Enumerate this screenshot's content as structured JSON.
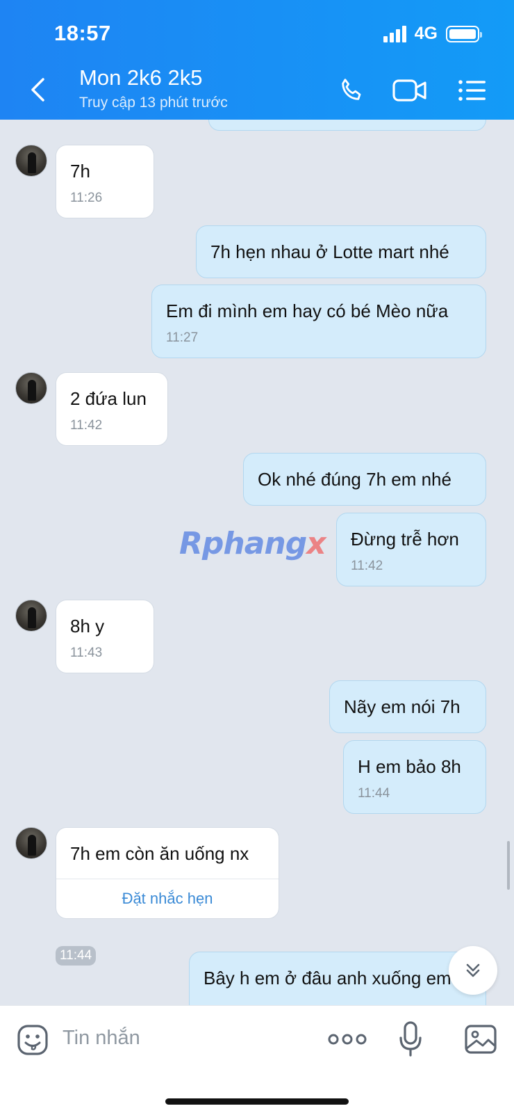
{
  "status": {
    "time": "18:57",
    "network": "4G"
  },
  "header": {
    "title": "Mon 2k6 2k5",
    "subtitle": "Truy cập 13 phút trước"
  },
  "messages": [
    {
      "dir": "in",
      "text": "7h",
      "time": "11:26"
    },
    {
      "dir": "out",
      "text": "7h hẹn nhau ở Lotte mart nhé"
    },
    {
      "dir": "out",
      "text": "Em đi mình em hay có bé Mèo nữa",
      "time": "11:27"
    },
    {
      "dir": "in",
      "text": "2 đứa lun",
      "time": "11:42"
    },
    {
      "dir": "out",
      "text": "Ok nhé đúng 7h em nhé"
    },
    {
      "dir": "out",
      "text": "Đừng trễ hơn",
      "time": "11:42"
    },
    {
      "dir": "in",
      "text": "8h y",
      "time": "11:43"
    },
    {
      "dir": "out",
      "text": "Nãy em nói 7h"
    },
    {
      "dir": "out",
      "text": "H em bảo 8h",
      "time": "11:44"
    },
    {
      "dir": "in",
      "text": "7h em còn ăn uống nx",
      "action": "Đặt nhắc hẹn",
      "time": "11:44"
    },
    {
      "dir": "out",
      "text": "Bây h em ở đâu anh xuống em"
    }
  ],
  "watermark": {
    "main": "Rphang",
    "accent": "x"
  },
  "composer": {
    "placeholder": "Tin nhắn"
  },
  "colors": {
    "header": "#1e84f3",
    "out_bubble": "#d4ecfb",
    "in_bubble": "#ffffff",
    "background": "#e1e6ee",
    "link": "#3a8ad6"
  },
  "icons": [
    "back-icon",
    "phone-icon",
    "video-call-icon",
    "menu-list-icon",
    "chevron-double-down-icon",
    "sticker-icon",
    "more-icon",
    "mic-icon",
    "image-icon"
  ]
}
